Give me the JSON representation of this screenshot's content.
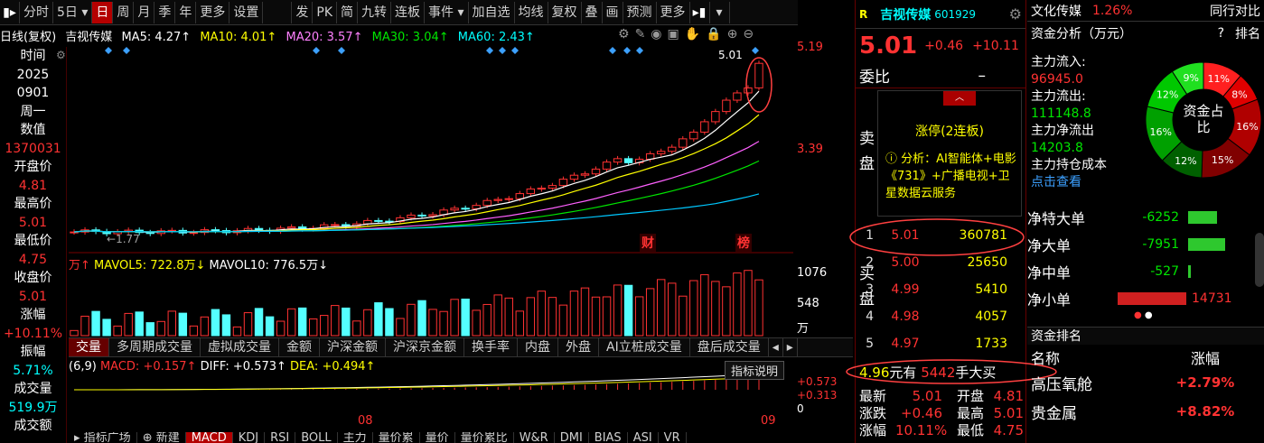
{
  "toolbar": {
    "items": [
      "分时",
      "5日",
      "日",
      "周",
      "月",
      "季",
      "年",
      "更多",
      "设置",
      "发",
      "PK",
      "简",
      "九转",
      "连板",
      "事件",
      "加自选",
      "均线",
      "复权",
      "叠",
      "画",
      "预测",
      "更多"
    ],
    "active": "日"
  },
  "chart_header": {
    "period": "日线(复权)",
    "name": "吉视传媒",
    "ma5": "MA5: 4.27↑",
    "ma10": "MA10: 4.01↑",
    "ma20": "MA20: 3.57↑",
    "ma30": "MA30: 3.04↑",
    "ma60": "MA60: 2.43↑"
  },
  "left_info": [
    {
      "label": "时间",
      "value": ""
    },
    {
      "label": "2025",
      "value": ""
    },
    {
      "label": "0901",
      "value": ""
    },
    {
      "label": "周一",
      "value": ""
    },
    {
      "label": "数值",
      "value": "1370031"
    },
    {
      "label": "开盘价",
      "value": "4.81"
    },
    {
      "label": "最高价",
      "value": "5.01"
    },
    {
      "label": "最低价",
      "value": "4.75"
    },
    {
      "label": "收盘价",
      "value": "5.01"
    },
    {
      "label": "涨幅",
      "value": "+10.11%"
    },
    {
      "label": "振幅",
      "value": "5.71%"
    },
    {
      "label": "成交量",
      "value": "519.9万"
    },
    {
      "label": "成交额",
      "value": ""
    }
  ],
  "axis": {
    "price_top": "5.19",
    "price_mid": "3.39",
    "vol_top": "1076",
    "vol_mid": "548",
    "vol_unit": "万",
    "macd_top": "+0.573",
    "macd_mid": "+0.313",
    "macd_bot": "0",
    "date_08": "08",
    "date_09": "09",
    "high_mark": "5.01",
    "low_mark": "1.77",
    "mark_cai": "财",
    "mark_bang": "榜"
  },
  "volume_header": {
    "unit": "万↑",
    "mavol5": "MAVOL5: 722.8万↓",
    "mavol10": "MAVOL10: 776.5万↓"
  },
  "volume_tabs": [
    "交量",
    "多周期成交量",
    "虚拟成交量",
    "金额",
    "沪深金额",
    "沪深京金额",
    "换手率",
    "内盘",
    "外盘",
    "AI立桩成交量",
    "盘后成交量"
  ],
  "macd_header": {
    "params": "(6,9)",
    "macd": "MACD: +0.157↑",
    "diff": "DIFF: +0.573↑",
    "dea": "DEA: +0.494↑",
    "button": "指标说明"
  },
  "bottom_tabs": [
    "指标广场",
    "新建",
    "MACD",
    "KDJ",
    "RSI",
    "BOLL",
    "主力",
    "量价累",
    "量价",
    "量价累比",
    "W&R",
    "DMI",
    "BIAS",
    "ASI",
    "VR"
  ],
  "bottom_active": "MACD",
  "quote": {
    "badge": "R",
    "name": "吉视传媒",
    "code": "601929",
    "price": "5.01",
    "change": "+0.46",
    "change_pct": "+10.11",
    "webi_label": "委比",
    "webi_value": "–",
    "sell_label": "卖盘",
    "buy_label": "买盘",
    "limit_up": "涨停(2连板)",
    "analysis": "分析：AI智能体+电影《731》+广播电视+卫星数据云服务",
    "bids": [
      {
        "level": "1",
        "price": "5.01",
        "volume": "360781"
      },
      {
        "level": "2",
        "price": "5.00",
        "volume": "25650"
      },
      {
        "level": "3",
        "price": "4.99",
        "volume": "5410"
      },
      {
        "level": "4",
        "price": "4.98",
        "volume": "4057"
      },
      {
        "level": "5",
        "price": "4.97",
        "volume": "1733"
      }
    ],
    "big_buy_price": "4.96",
    "big_buy_text1": "元有",
    "big_buy_volume": "5442",
    "big_buy_text2": "手大买",
    "stats": [
      {
        "label": "最新",
        "value": "5.01",
        "label2": "开盘",
        "value2": "4.81"
      },
      {
        "label": "涨跌",
        "value": "+0.46",
        "label2": "最高",
        "value2": "5.01"
      },
      {
        "label": "涨幅",
        "value": "10.11%",
        "label2": "最低",
        "value2": "4.75"
      }
    ]
  },
  "fund": {
    "sector": "文化传媒",
    "sector_pct": "1.26%",
    "compare": "同行对比",
    "title": "资金分析（万元）",
    "rank_btn": "排名",
    "main_in_label": "主力流入:",
    "main_in": "96945.0",
    "main_out_label": "主力流出:",
    "main_out": "111148.8",
    "net_label": "主力净流出",
    "net": "14203.8",
    "cost_label": "主力持仓成本",
    "cost_link": "点击查看",
    "donut_center": "资金占比",
    "donut": [
      {
        "pct": "11%",
        "value": 11,
        "color": "#ff2020"
      },
      {
        "pct": "8%",
        "value": 8,
        "color": "#e00000"
      },
      {
        "pct": "16%",
        "value": 16,
        "color": "#b00000"
      },
      {
        "pct": "15%",
        "value": 15,
        "color": "#800000"
      },
      {
        "pct": "12%",
        "value": 12,
        "color": "#006000"
      },
      {
        "pct": "16%",
        "value": 16,
        "color": "#00a000"
      },
      {
        "pct": "12%",
        "value": 12,
        "color": "#00c800"
      },
      {
        "pct": "9%",
        "value": 9,
        "color": "#20e020"
      }
    ],
    "flows": [
      {
        "label": "净特大单",
        "value": "-6252",
        "ratio": 0.42,
        "color": "#2ec82e"
      },
      {
        "label": "净大单",
        "value": "-7951",
        "ratio": 0.54,
        "color": "#2ec82e"
      },
      {
        "label": "净中单",
        "value": "-527",
        "ratio": 0.04,
        "color": "#2ec82e"
      },
      {
        "label": "净小单",
        "value": "14731",
        "ratio": 1.0,
        "color": "#d02020"
      }
    ],
    "rank_title": "资金排名",
    "rank_col1": "名称",
    "rank_col2": "涨幅",
    "rank_rows": [
      {
        "name": "高压氧舱",
        "pct": "+2.79%"
      },
      {
        "name": "贵金属",
        "pct": "+8.82%"
      }
    ]
  }
}
